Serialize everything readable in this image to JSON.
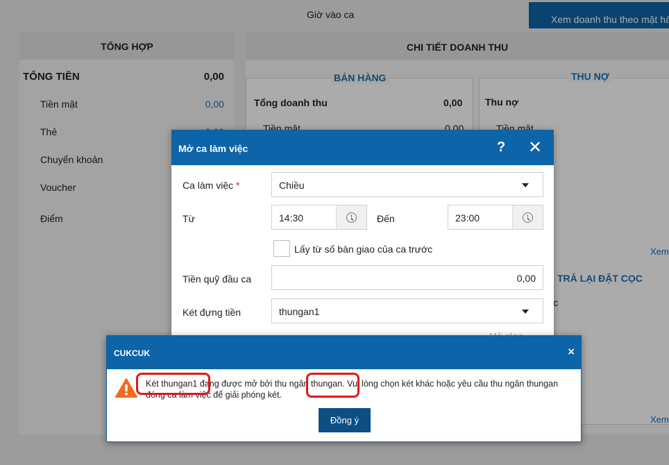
{
  "top": {
    "time_label": "Giờ vào ca",
    "revenue_button": "Xem doanh thu theo mặt hàng"
  },
  "summary": {
    "header": "TỔNG HỢP",
    "total_label": "TỔNG TIỀN",
    "total_value": "0,00",
    "items": [
      {
        "label": "Tiền mặt",
        "value": "0,00"
      },
      {
        "label": "Thẻ",
        "value": "0,00"
      },
      {
        "label": "Chuyển khoản",
        "value": ""
      },
      {
        "label": "Voucher",
        "value": ""
      },
      {
        "label": "Điểm",
        "value": ""
      }
    ]
  },
  "detail": {
    "header": "CHI TIẾT DOANH THU",
    "sales_title": "BÁN HÀNG",
    "sales_total_label": "Tổng doanh thu",
    "sales_total_value": "0,00",
    "sales_cash_label": "Tiền mặt",
    "sales_cash_value": "0,00",
    "debt_title": "THU NỢ",
    "debt_label": "Thu nợ",
    "debt_cash_label": "Tiền mặt",
    "view_link": "Xem",
    "deposit_title": "TRẢ LẠI ĐẶT CỌC",
    "deposit_partial": "c",
    "view_link_2": "Xem"
  },
  "shift_dialog": {
    "title": "Mở ca làm việc",
    "help": "?",
    "close": "✕",
    "shift_label": "Ca làm việc",
    "required_mark": "*",
    "shift_value": "Chiều",
    "from_label": "Từ",
    "from_value": "14:30",
    "to_label": "Đến",
    "to_value": "23:00",
    "handover_checkbox_label": "Lấy từ số bàn giao của ca trước",
    "handover_checked": false,
    "opening_fund_label": "Tiền quỹ đầu ca",
    "opening_fund_value": "0,00",
    "cash_drawer_label": "Két đựng tiền",
    "cash_drawer_value": "thungan1",
    "more_link": "Mở rộng"
  },
  "alert": {
    "title": "CUKCUK",
    "close": "×",
    "message_line1": "Két thungan1 đang được mở bởi thu ngân thungan. Vui lòng chọn két khác hoặc yêu cầu thu ngân thungan",
    "message_line2": "đóng ca làm việc để giải phóng két.",
    "ok_button": "Đồng ý"
  },
  "colors": {
    "primary": "#0d64a8",
    "link": "#1a6fb5",
    "warning": "#f26b1d",
    "highlight": "#e01818"
  }
}
